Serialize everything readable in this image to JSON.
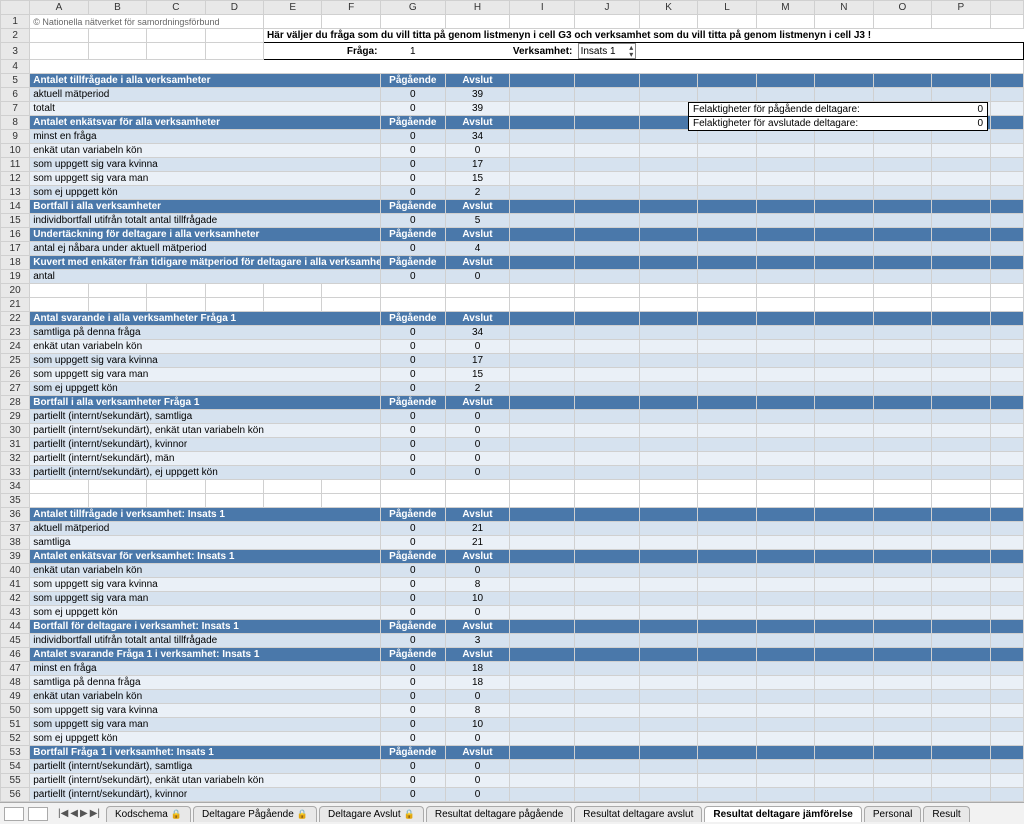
{
  "rowhead_width_col": "",
  "columns": [
    "A",
    "B",
    "C",
    "D",
    "E",
    "F",
    "G",
    "H",
    "I",
    "J",
    "K",
    "L",
    "M",
    "N",
    "O",
    "P",
    ""
  ],
  "note": "© Nationella nätverket för samordningsförbund",
  "instruction": "Här väljer du fråga som du vill titta på genom listmenyn i cell G3 och verksamhet som du vill titta på genom listmenyn i cell J3 !",
  "labels": {
    "fraga": "Fråga:",
    "verksamhet": "Verksamhet:"
  },
  "fraga_value": "1",
  "verksamhet_value": "Insats 1",
  "errbox": {
    "line1_label": "Felaktigheter för pågående deltagare:",
    "line1_val": "0",
    "line2_label": "Felaktigheter för avslutade deltagare:",
    "line2_val": "0"
  },
  "col_hdr": {
    "pag": "Pågående",
    "avs": "Avslut"
  },
  "rows": [
    {
      "n": 5,
      "t": "hdr",
      "a": "Antalet tillfrågade i alla verksamheter",
      "g": "Pågående",
      "h": "Avslut"
    },
    {
      "n": 6,
      "t": "a",
      "a": "aktuell mätperiod",
      "g": "0",
      "h": "39"
    },
    {
      "n": 7,
      "t": "b",
      "a": "totalt",
      "g": "0",
      "h": "39"
    },
    {
      "n": 8,
      "t": "hdr",
      "a": "Antalet enkätsvar för alla verksamheter",
      "g": "Pågående",
      "h": "Avslut"
    },
    {
      "n": 9,
      "t": "a",
      "a": "minst en fråga",
      "g": "0",
      "h": "34"
    },
    {
      "n": 10,
      "t": "b",
      "a": "enkät utan variabeln kön",
      "g": "0",
      "h": "0"
    },
    {
      "n": 11,
      "t": "a",
      "a": "som uppgett sig vara kvinna",
      "g": "0",
      "h": "17"
    },
    {
      "n": 12,
      "t": "b",
      "a": "som uppgett sig vara man",
      "g": "0",
      "h": "15"
    },
    {
      "n": 13,
      "t": "a",
      "a": "som ej uppgett kön",
      "g": "0",
      "h": "2"
    },
    {
      "n": 14,
      "t": "hdr",
      "a": "Bortfall i alla verksamheter",
      "g": "Pågående",
      "h": "Avslut"
    },
    {
      "n": 15,
      "t": "a",
      "a": "individbortfall utifrån totalt antal tillfrågade",
      "g": "0",
      "h": "5"
    },
    {
      "n": 16,
      "t": "hdr",
      "a": "Undertäckning för deltagare i alla verksamheter",
      "g": "Pågående",
      "h": "Avslut"
    },
    {
      "n": 17,
      "t": "a",
      "a": "antal ej nåbara under aktuell mätperiod",
      "g": "0",
      "h": "4"
    },
    {
      "n": 18,
      "t": "hdr",
      "a": "Kuvert med enkäter från tidigare mätperiod för deltagare i alla verksamheter",
      "g": "Pågående",
      "h": "Avslut"
    },
    {
      "n": 19,
      "t": "a",
      "a": "antal",
      "g": "0",
      "h": "0"
    },
    {
      "n": 20,
      "t": "blank"
    },
    {
      "n": 21,
      "t": "blank"
    },
    {
      "n": 22,
      "t": "hdr",
      "a": "Antal svarande i alla verksamheter Fråga 1",
      "g": "Pågående",
      "h": "Avslut"
    },
    {
      "n": 23,
      "t": "a",
      "a": "samtliga på denna fråga",
      "g": "0",
      "h": "34"
    },
    {
      "n": 24,
      "t": "b",
      "a": "enkät utan variabeln kön",
      "g": "0",
      "h": "0"
    },
    {
      "n": 25,
      "t": "a",
      "a": "som uppgett sig vara kvinna",
      "g": "0",
      "h": "17"
    },
    {
      "n": 26,
      "t": "b",
      "a": "som uppgett sig vara man",
      "g": "0",
      "h": "15"
    },
    {
      "n": 27,
      "t": "a",
      "a": "som ej uppgett kön",
      "g": "0",
      "h": "2"
    },
    {
      "n": 28,
      "t": "hdr",
      "a": "Bortfall i alla verksamheter Fråga 1",
      "g": "Pågående",
      "h": "Avslut"
    },
    {
      "n": 29,
      "t": "a",
      "a": "partiellt (internt/sekundärt), samtliga",
      "g": "0",
      "h": "0"
    },
    {
      "n": 30,
      "t": "b",
      "a": "partiellt (internt/sekundärt), enkät utan variabeln kön",
      "g": "0",
      "h": "0"
    },
    {
      "n": 31,
      "t": "a",
      "a": "partiellt (internt/sekundärt), kvinnor",
      "g": "0",
      "h": "0"
    },
    {
      "n": 32,
      "t": "b",
      "a": "partiellt (internt/sekundärt), män",
      "g": "0",
      "h": "0"
    },
    {
      "n": 33,
      "t": "a",
      "a": "partiellt (internt/sekundärt), ej uppgett kön",
      "g": "0",
      "h": "0"
    },
    {
      "n": 34,
      "t": "blank"
    },
    {
      "n": 35,
      "t": "blank"
    },
    {
      "n": 36,
      "t": "hdr",
      "a": "Antalet tillfrågade i verksamhet: Insats 1",
      "g": "Pågående",
      "h": "Avslut"
    },
    {
      "n": 37,
      "t": "a",
      "a": "aktuell mätperiod",
      "g": "0",
      "h": "21"
    },
    {
      "n": 38,
      "t": "b",
      "a": "samtliga",
      "g": "0",
      "h": "21"
    },
    {
      "n": 39,
      "t": "hdr",
      "a": "Antalet enkätsvar för verksamhet: Insats 1",
      "g": "Pågående",
      "h": "Avslut"
    },
    {
      "n": 40,
      "t": "a",
      "a": "enkät utan variabeln kön",
      "g": "0",
      "h": "0"
    },
    {
      "n": 41,
      "t": "b",
      "a": "som uppgett sig vara kvinna",
      "g": "0",
      "h": "8"
    },
    {
      "n": 42,
      "t": "a",
      "a": "som uppgett sig vara man",
      "g": "0",
      "h": "10"
    },
    {
      "n": 43,
      "t": "b",
      "a": "som ej uppgett kön",
      "g": "0",
      "h": "0"
    },
    {
      "n": 44,
      "t": "hdr",
      "a": "Bortfall för deltagare i verksamhet: Insats 1",
      "g": "Pågående",
      "h": "Avslut"
    },
    {
      "n": 45,
      "t": "a",
      "a": "individbortfall utifrån totalt antal tillfrågade",
      "g": "0",
      "h": "3"
    },
    {
      "n": 46,
      "t": "hdr",
      "a": "Antalet svarande Fråga 1 i verksamhet: Insats 1",
      "g": "Pågående",
      "h": "Avslut"
    },
    {
      "n": 47,
      "t": "a",
      "a": "minst en fråga",
      "g": "0",
      "h": "18"
    },
    {
      "n": 48,
      "t": "b",
      "a": "samtliga på denna fråga",
      "g": "0",
      "h": "18"
    },
    {
      "n": 49,
      "t": "a",
      "a": "enkät utan variabeln kön",
      "g": "0",
      "h": "0"
    },
    {
      "n": 50,
      "t": "b",
      "a": "som uppgett sig vara kvinna",
      "g": "0",
      "h": "8"
    },
    {
      "n": 51,
      "t": "a",
      "a": "som uppgett sig vara man",
      "g": "0",
      "h": "10"
    },
    {
      "n": 52,
      "t": "b",
      "a": "som ej uppgett kön",
      "g": "0",
      "h": "0"
    },
    {
      "n": 53,
      "t": "hdr",
      "a": "Bortfall Fråga 1 i verksamhet: Insats 1",
      "g": "Pågående",
      "h": "Avslut"
    },
    {
      "n": 54,
      "t": "a",
      "a": "partiellt (internt/sekundärt), samtliga",
      "g": "0",
      "h": "0"
    },
    {
      "n": 55,
      "t": "b",
      "a": "partiellt (internt/sekundärt), enkät utan variabeln kön",
      "g": "0",
      "h": "0"
    },
    {
      "n": 56,
      "t": "a",
      "a": "partiellt (internt/sekundärt), kvinnor",
      "g": "0",
      "h": "0"
    }
  ],
  "tabs": {
    "items": [
      {
        "label": "Kodschema",
        "lock": true
      },
      {
        "label": "Deltagare Pågående",
        "lock": true
      },
      {
        "label": "Deltagare Avslut",
        "lock": true
      },
      {
        "label": "Resultat deltagare pågående",
        "lock": false
      },
      {
        "label": "Resultat deltagare avslut",
        "lock": false
      },
      {
        "label": "Resultat deltagare jämförelse",
        "lock": false,
        "active": true
      },
      {
        "label": "Personal",
        "lock": false
      },
      {
        "label": "Result",
        "lock": false
      }
    ]
  }
}
